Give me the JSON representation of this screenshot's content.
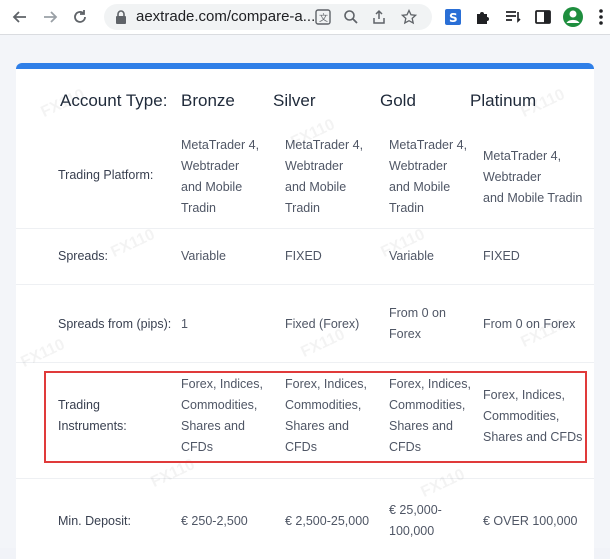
{
  "browser": {
    "url": "aextrade.com/compare-a...",
    "back_icon": "arrow-left",
    "forward_icon": "arrow-right",
    "reload_icon": "reload",
    "lock_icon": "lock"
  },
  "table": {
    "accent_color": "#2f7fe8",
    "highlight_color": "#e03a3a",
    "header": {
      "label": "Account Type:",
      "cols": [
        "Bronze",
        "Silver",
        "Gold",
        "Platinum"
      ]
    },
    "rows": [
      {
        "label": "Trading Platform:",
        "cells": [
          [
            "MetaTrader 4,",
            "Webtrader",
            "and Mobile",
            "Tradin"
          ],
          [
            "MetaTrader 4,",
            "Webtrader",
            "and Mobile",
            "Tradin"
          ],
          [
            "MetaTrader 4,",
            "Webtrader",
            "and Mobile",
            "Tradin"
          ],
          [
            "MetaTrader 4,",
            "Webtrader",
            "and Mobile Tradin"
          ]
        ]
      },
      {
        "label": "Spreads:",
        "cells": [
          [
            "Variable"
          ],
          [
            "FIXED"
          ],
          [
            "Variable"
          ],
          [
            "FIXED"
          ]
        ]
      },
      {
        "label": "Spreads from (pips):",
        "cells": [
          [
            "1"
          ],
          [
            "Fixed (Forex)"
          ],
          [
            "From 0 on",
            "Forex"
          ],
          [
            "From 0 on Forex"
          ]
        ]
      },
      {
        "label": [
          "Trading",
          "Instruments:"
        ],
        "cells": [
          [
            "Forex, Indices,",
            "Commodities,",
            "Shares and",
            "CFDs"
          ],
          [
            "Forex, Indices,",
            "Commodities,",
            "Shares and",
            "CFDs"
          ],
          [
            "Forex, Indices,",
            "Commodities,",
            "Shares and",
            "CFDs"
          ],
          [
            "Forex, Indices,",
            "Commodities,",
            "Shares and CFDs"
          ]
        ]
      },
      {
        "label": "Min. Deposit:",
        "cells": [
          [
            "€ 250-2,500"
          ],
          [
            "€ 2,500-25,000"
          ],
          [
            "€ 25,000-",
            "100,000"
          ],
          [
            "€ OVER 100,000"
          ]
        ]
      }
    ]
  }
}
